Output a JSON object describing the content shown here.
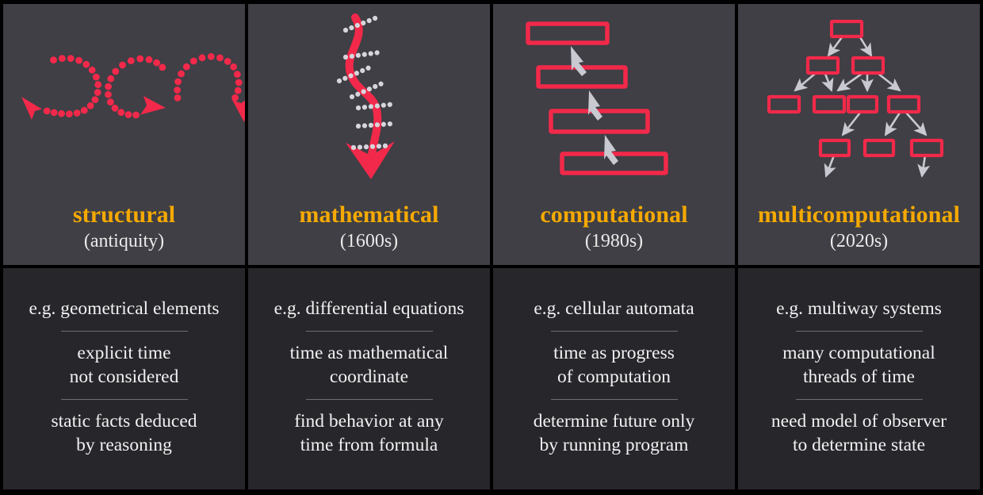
{
  "theme": {
    "page_background": "#000000",
    "top_panel_background": "#3f3f45",
    "bottom_panel_background": "#26262b",
    "title_color": "#f5a900",
    "subtitle_color": "#eceaea",
    "body_text_color": "#f2f1f1",
    "rule_color": "#6e6e74",
    "accent_red": "#f2294a",
    "arrow_gray": "#c9c9d2"
  },
  "columns": [
    {
      "id": "structural",
      "title": "structural",
      "period": "(antiquity)",
      "figure": "dotted-circular-arrows-icon",
      "notes": [
        "e.g. geometrical elements",
        "explicit time\nnot considered",
        "static facts deduced\nby reasoning"
      ]
    },
    {
      "id": "mathematical",
      "title": "mathematical",
      "period": "(1600s)",
      "figure": "wavy-time-arrow-icon",
      "notes": [
        "e.g. differential equations",
        "time as mathematical\ncoordinate",
        "find behavior at any\ntime from formula"
      ]
    },
    {
      "id": "computational",
      "title": "computational",
      "period": "(1980s)",
      "figure": "cascading-steps-icon",
      "notes": [
        "e.g. cellular automata",
        "time as progress\nof computation",
        "determine future only\nby running program"
      ]
    },
    {
      "id": "multicomputational",
      "title": "multicomputational",
      "period": "(2020s)",
      "figure": "multiway-graph-icon",
      "notes": [
        "e.g.  multiway systems",
        "many computational\nthreads of time",
        "need model of observer\nto determine state"
      ]
    }
  ]
}
